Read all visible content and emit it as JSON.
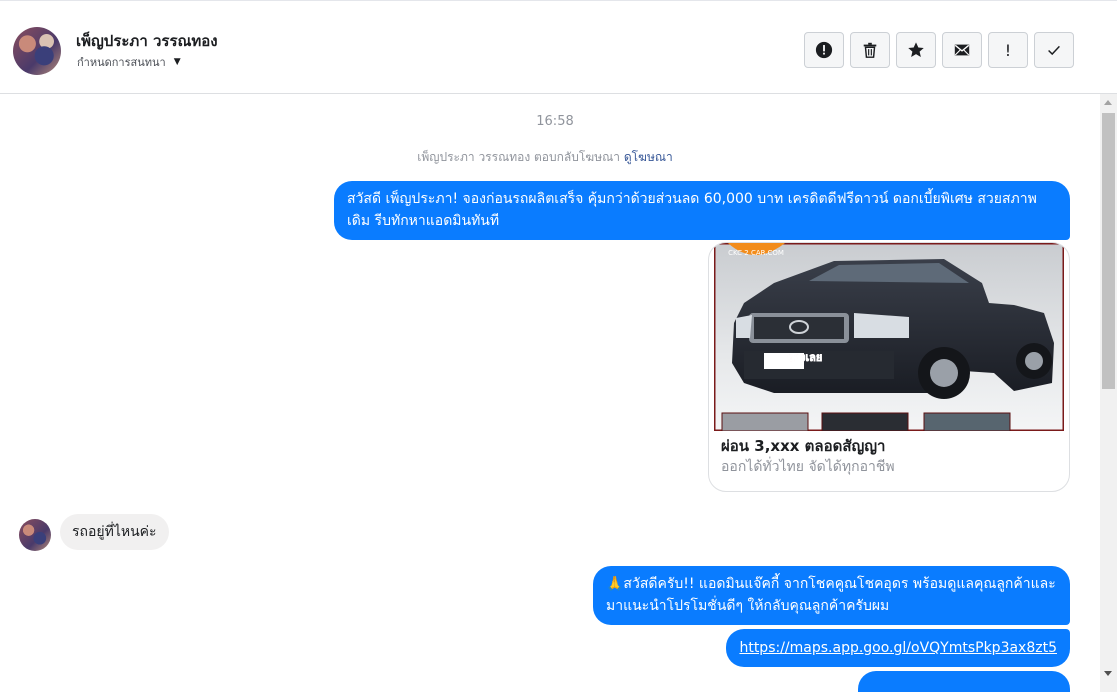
{
  "header": {
    "contact_name": "เพ็ญประภา วรรณทอง",
    "subtitle": "กำหนดการสนทนา",
    "toolbar": [
      {
        "icon": "alert-circle-icon",
        "name": "report-button"
      },
      {
        "icon": "trash-icon",
        "name": "delete-button"
      },
      {
        "icon": "star-icon",
        "name": "star-button"
      },
      {
        "icon": "envelope-icon",
        "name": "mark-unread-button"
      },
      {
        "icon": "exclamation-icon",
        "name": "spam-button"
      },
      {
        "icon": "check-icon",
        "name": "mark-done-button"
      }
    ]
  },
  "chat": {
    "timestamp": "16:58",
    "notice_text": "เพ็ญประภา วรรณทอง ตอบกลับโฆษณา",
    "notice_link": "ดูโฆษณา",
    "messages": [
      {
        "from": "page",
        "text": "สวัสดี เพ็ญประภา! จองก่อนรถผลิตเสร็จ คุ้มกว่าด้วยส่วนลด 60,000 บาท เครดิตดีฟรีดาวน์ ดอกเบี้ยพิเศษ สวยสภาพเดิม รีบทักหาแอดมินทันที"
      },
      {
        "from": "page",
        "type": "ad_card",
        "badge": "CKC 2 CAR.COM",
        "sticker": "จองเลย",
        "title": "ผ่อน 3,xxx ตลอดสัญญา",
        "subtitle": "ออกได้ทั่วไทย จัดได้ทุกอาชีพ"
      },
      {
        "from": "user",
        "text": "รถอยู่ที่ไหนค่ะ"
      },
      {
        "from": "page",
        "text": "🙏สวัสดีครับ!! แอดมินแจ๊คกี้ จากโชคคูณโชคอุดร พร้อมดูแลคุณลูกค้าและมาแนะนำโปรโมชั่นดีๆ ให้กลับคุณลูกค้าครับผม"
      },
      {
        "from": "page",
        "text": "https://maps.app.goo.gl/oVQYmtsPkp3ax8zt5"
      }
    ]
  },
  "colors": {
    "outgoing_bubble": "#0a7cff",
    "incoming_bubble": "#f1f0f0",
    "link": "#385898"
  }
}
